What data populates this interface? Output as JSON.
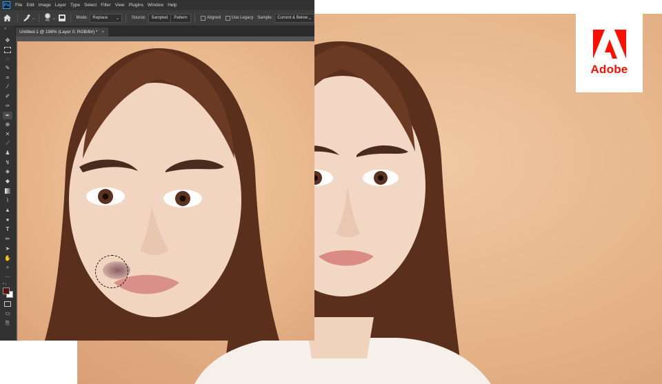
{
  "menubar": {
    "logo": "Ps",
    "items": [
      "File",
      "Edit",
      "Image",
      "Layer",
      "Type",
      "Select",
      "Filter",
      "View",
      "Plugins",
      "Window",
      "Help"
    ]
  },
  "options_bar": {
    "home_icon": "home-icon",
    "tool_icon": "healing-brush-icon",
    "brush_size": "40",
    "mode_label": "Mode:",
    "mode_value": "Replace",
    "source_label": "Source:",
    "source_options": [
      "Sampled",
      "Pattern"
    ],
    "aligned_label": "Aligned",
    "use_legacy_label": "Use Legacy",
    "sample_label": "Sample:",
    "sample_value": "Current & Below"
  },
  "document": {
    "tab_title": "Untitled-1 @ 198% (Layer 0, RGB/8#) *",
    "close": "×"
  },
  "toolbar": {
    "collapse": "»",
    "tools": [
      "move-tool-icon",
      "marquee-tool-icon",
      "lasso-tool-icon",
      "quick-selection-icon",
      "crop-tool-icon",
      "eyedropper-icon",
      "spot-healing-icon",
      "healing-brush-icon",
      "patch-tool-icon",
      "red-eye-icon",
      "brush-tool-icon",
      "clone-stamp-icon",
      "history-brush-icon",
      "eraser-icon",
      "gradient-icon",
      "blur-icon",
      "dodge-icon",
      "pen-icon",
      "type-tool-icon",
      "path-selection-icon",
      "direct-selection-icon",
      "hand-tool-icon",
      "zoom-tool-icon",
      "more-tools-icon"
    ],
    "foreground_color": "#5a1010",
    "background_color": "#ffffff"
  },
  "brand": {
    "name": "Adobe",
    "color": "#fa0f00"
  }
}
